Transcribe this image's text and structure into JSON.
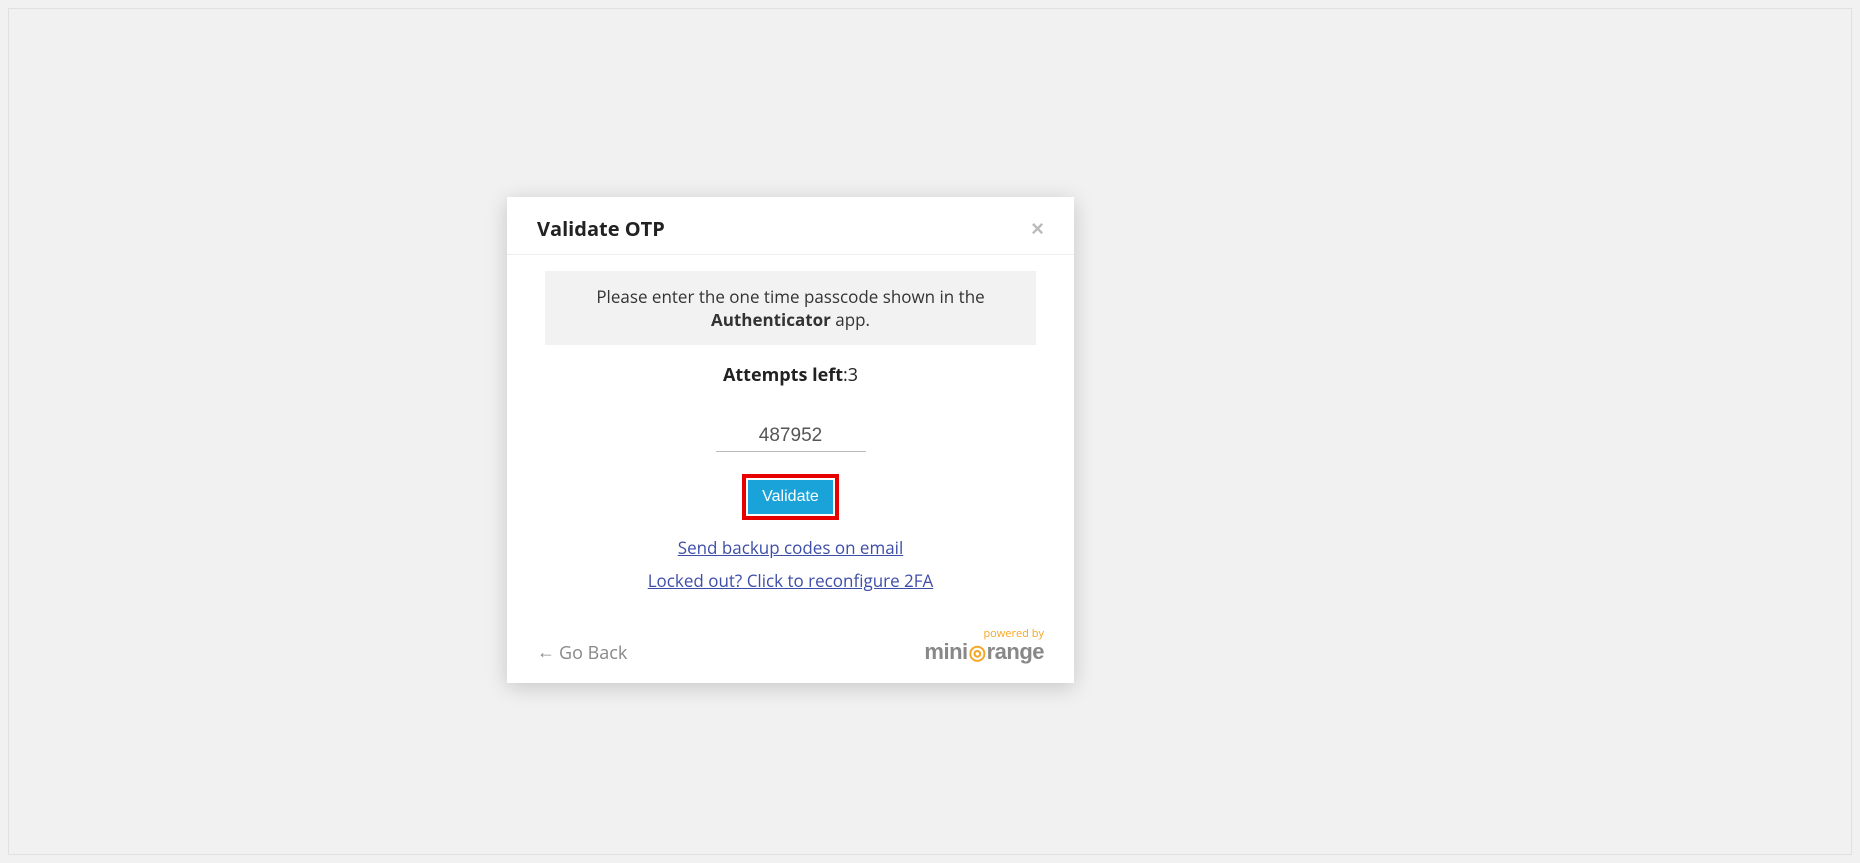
{
  "modal": {
    "title": "Validate OTP",
    "close_glyph": "×",
    "instruction_prefix": "Please enter the one time passcode shown in the ",
    "instruction_bold": "Authenticator",
    "instruction_suffix": " app.",
    "attempts_label": "Attempts left",
    "attempts_value": ":3",
    "otp_value": "487952",
    "validate_label": "Validate",
    "backup_link": "Send backup codes on email",
    "locked_link": "Locked out? Click to reconfigure 2FA",
    "go_back_arrow": "←",
    "go_back_label": "Go Back",
    "powered_by": "powered by",
    "brand_a": "mini",
    "brand_b": "range"
  }
}
